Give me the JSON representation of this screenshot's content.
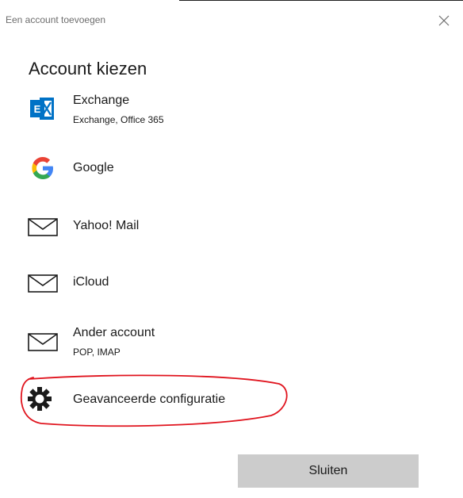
{
  "window": {
    "title": "Een account toevoegen"
  },
  "main": {
    "title": "Account kiezen",
    "accounts": [
      {
        "label": "Exchange",
        "sublabel": "Exchange, Office 365",
        "icon": "exchange-icon"
      },
      {
        "label": "Google",
        "icon": "google-icon"
      },
      {
        "label": "Yahoo! Mail",
        "icon": "mail-icon"
      },
      {
        "label": "iCloud",
        "icon": "mail-icon"
      },
      {
        "label": "Ander account",
        "sublabel": "POP, IMAP",
        "icon": "mail-icon"
      },
      {
        "label": "Geavanceerde configuratie",
        "icon": "gear-icon"
      }
    ]
  },
  "footer": {
    "close_label": "Sluiten"
  },
  "colors": {
    "exchange_blue": "#0072c6",
    "google_blue": "#4285f4",
    "google_red": "#ea4335",
    "google_yellow": "#fbbc05",
    "google_green": "#34a853",
    "annotation_red": "#e0141e",
    "button_gray": "#cccccc"
  }
}
